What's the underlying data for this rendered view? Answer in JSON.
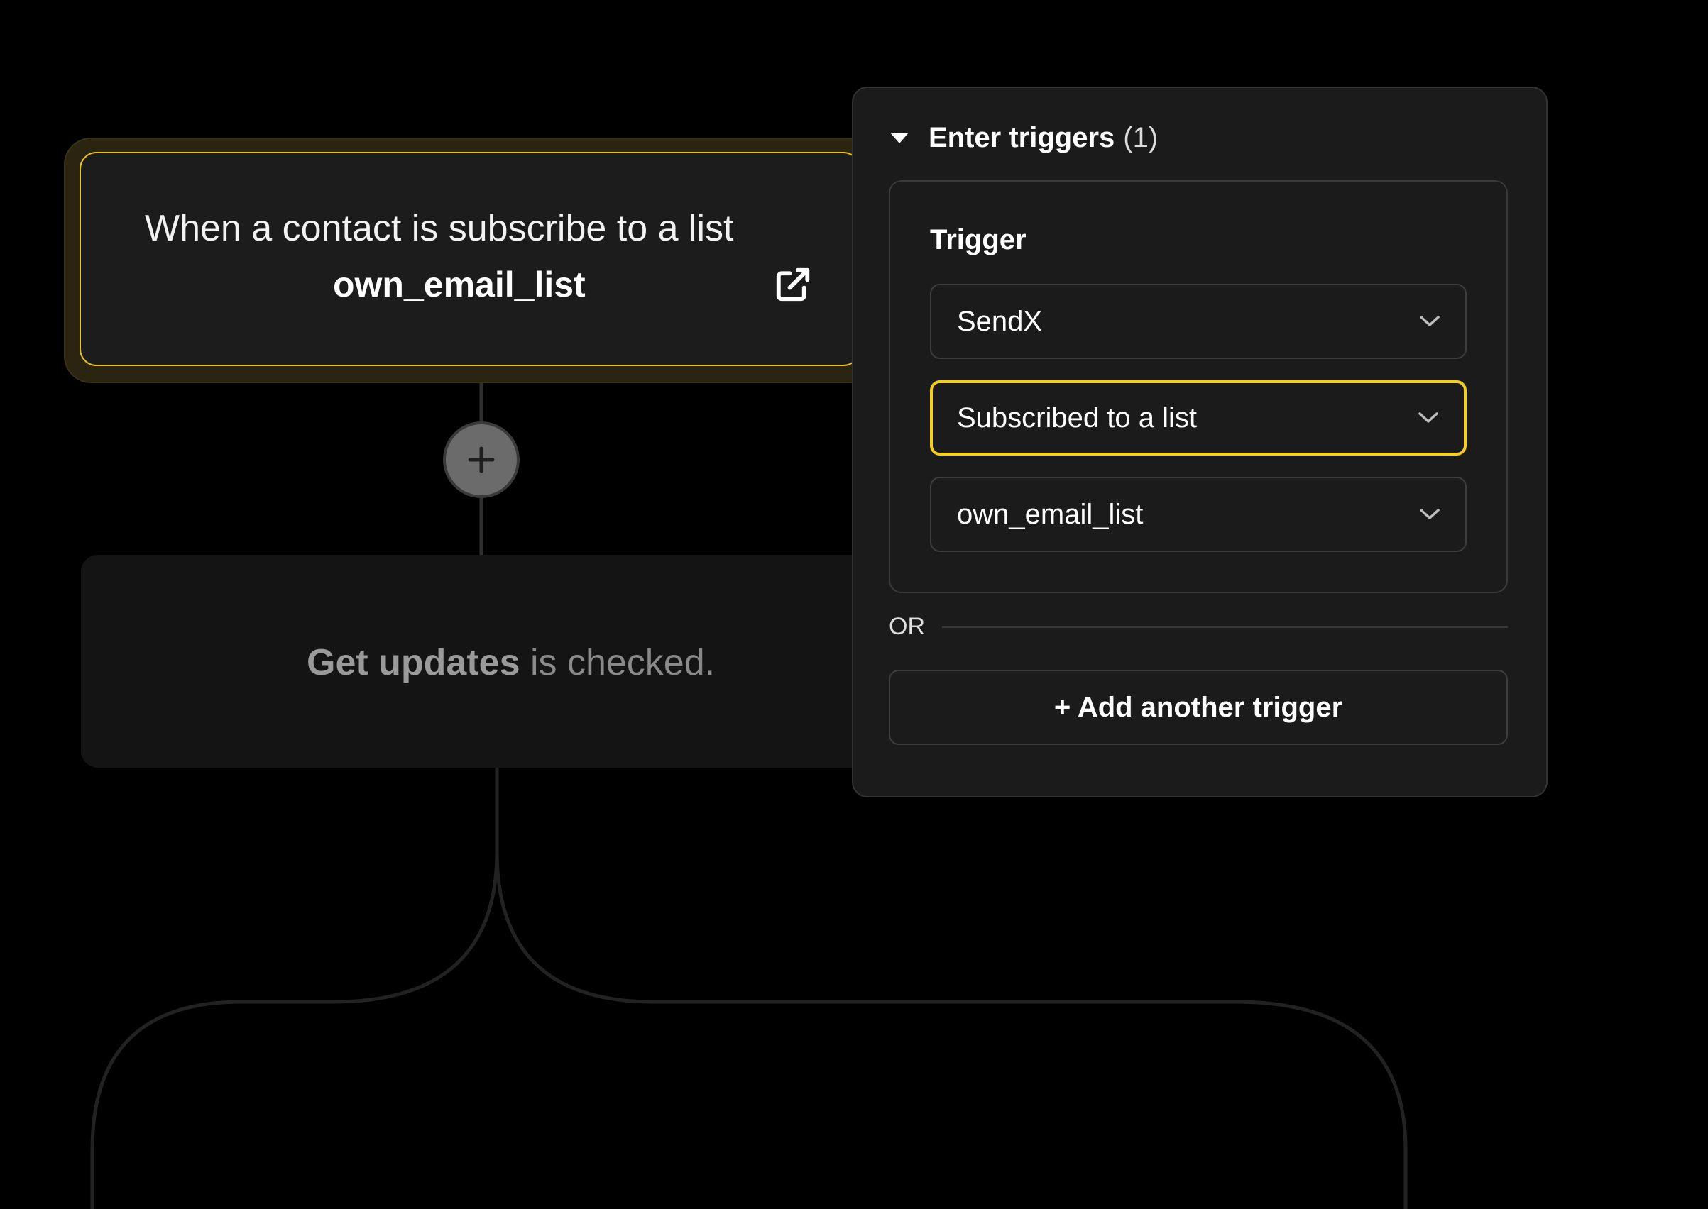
{
  "flow": {
    "trigger_card": {
      "description": "When a contact is subscribe to a list",
      "value": "own_email_list",
      "open_icon": "external-link-icon"
    },
    "add_step_icon": "plus-icon",
    "condition_card": {
      "field": "Get updates",
      "status": " is checked."
    }
  },
  "panel": {
    "header_title": "Enter triggers",
    "header_count": "(1)",
    "collapse_icon": "caret-down-icon",
    "trigger_label": "Trigger",
    "app_select": {
      "value": "SendX"
    },
    "event_select": {
      "value": "Subscribed to a list"
    },
    "list_select": {
      "value": "own_email_list"
    },
    "or_label": "OR",
    "add_trigger_label": "+ Add another trigger"
  },
  "colors": {
    "accent": "#f5cf1d",
    "background": "#000000",
    "panel": "#1b1b1b"
  }
}
